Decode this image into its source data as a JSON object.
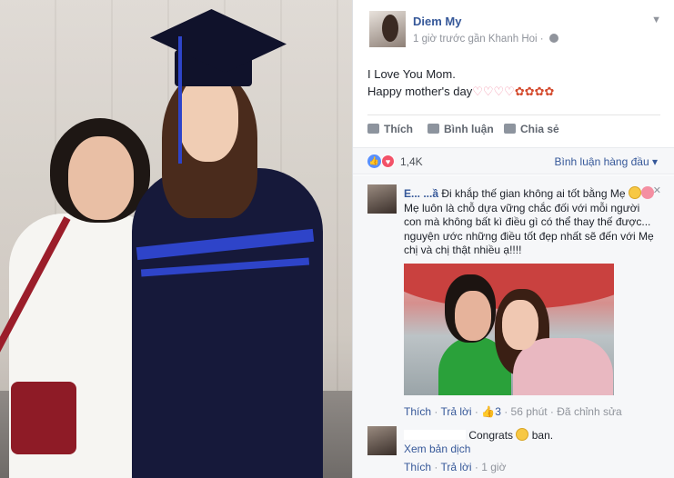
{
  "post": {
    "author": "Diem My",
    "meta": "1 giờ trước gần Khanh Hoi ·",
    "text_line1": "I Love You Mom.",
    "text_line2": "Happy mother's day",
    "hearts": "♡♡♡♡",
    "flowers": "✿✿✿✿"
  },
  "actions": {
    "like": "Thích",
    "comment": "Bình luận",
    "share": "Chia sẻ"
  },
  "reactions": {
    "count": "1,4K",
    "sort": "Bình luận hàng đầu"
  },
  "comments": [
    {
      "author": "E...  ...ầ",
      "text": "Đi khắp thế gian không ai tốt bằng Mẹ",
      "text2": "Mẹ luôn là chỗ dựa vững chắc đối với mỗi người con mà không bất kì điều gì có thể thay thế được... nguyện ước những điều tốt đẹp nhất sẽ đến với Mẹ chị và chị thật nhiều ạ!!!!",
      "like": "Thích",
      "reply": "Trả lời",
      "likes": "3",
      "time": "56 phút",
      "edited": "Đã chỉnh sửa"
    },
    {
      "text": "Congrats",
      "text_after": "ban.",
      "translate": "Xem bản dịch",
      "like": "Thích",
      "reply": "Trả lời",
      "time": "1 giờ"
    }
  ],
  "icons": {
    "chevron": "chevron-down-icon",
    "globe": "globe-icon",
    "like": "thumb-up-icon",
    "comment": "comment-icon",
    "share": "share-icon",
    "love": "heart-icon"
  },
  "colors": {
    "link": "#365899",
    "muted": "#90949c",
    "like_blue": "#5890ff",
    "love_red": "#f25268"
  }
}
